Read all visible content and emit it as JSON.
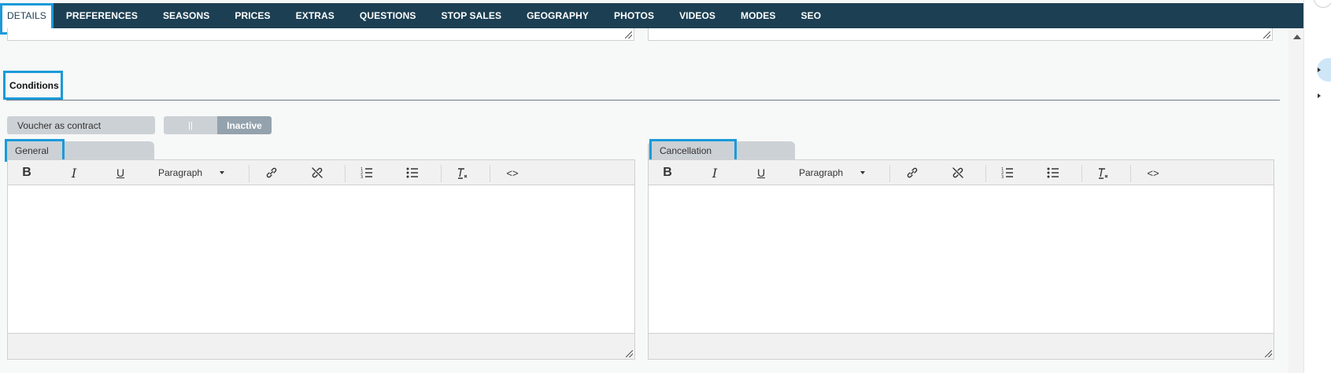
{
  "nav": {
    "tabs": [
      "DETAILS",
      "PREFERENCES",
      "SEASONS",
      "PRICES",
      "EXTRAS",
      "QUESTIONS",
      "STOP SALES",
      "GEOGRAPHY",
      "PHOTOS",
      "VIDEOS",
      "MODES",
      "SEO"
    ],
    "active": "DETAILS"
  },
  "conditions": {
    "title": "Conditions",
    "voucher_label": "Voucher as contract",
    "toggle_knob": "||",
    "toggle_state": "Inactive"
  },
  "editors": [
    {
      "tab_label": "General",
      "format_label": "Paragraph"
    },
    {
      "tab_label": "Cancellation",
      "format_label": "Paragraph"
    }
  ],
  "icons": {
    "bold": "B",
    "italic": "I",
    "underline": "U",
    "code": "<>",
    "clear_format": "T"
  },
  "colors": {
    "nav_bg": "#1c3f53",
    "highlight": "#1a9ad9",
    "tab_bg": "#ccd1d6",
    "toggle_state_bg": "#93a2ad"
  }
}
